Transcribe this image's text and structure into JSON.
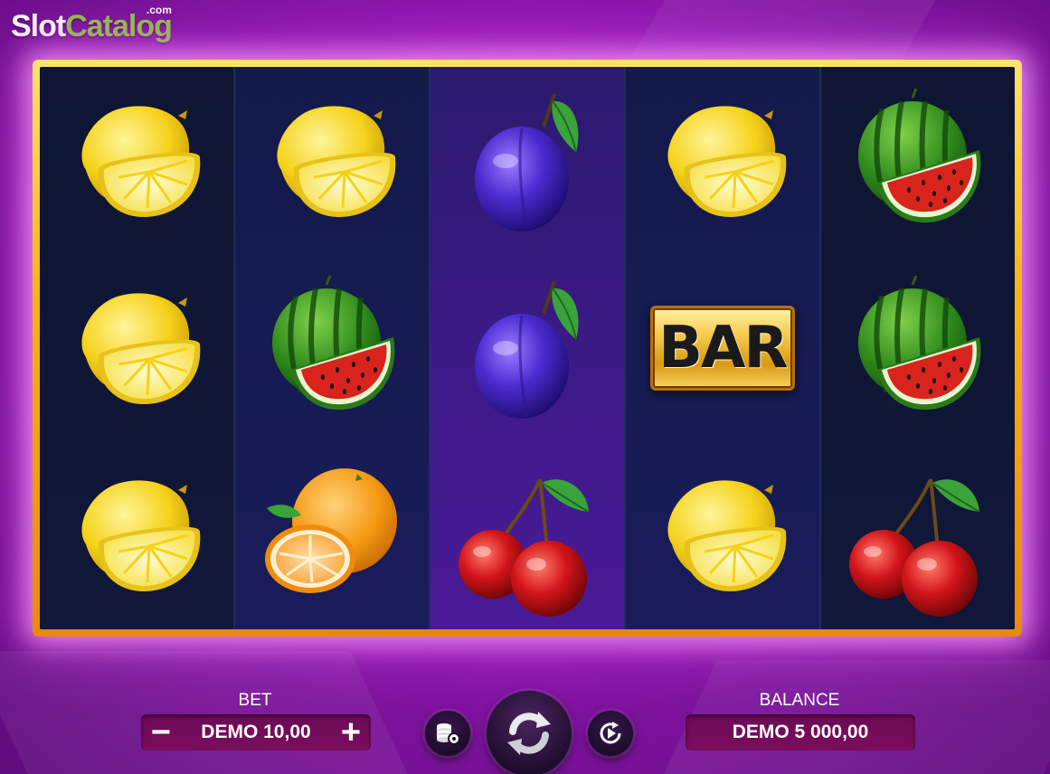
{
  "logo": {
    "slot": "Slot",
    "catalog": "Catalog",
    "com": ".com"
  },
  "reels": [
    [
      "lemon",
      "lemon",
      "lemon"
    ],
    [
      "lemon",
      "watermelon",
      "orange"
    ],
    [
      "plum",
      "plum",
      "cherry"
    ],
    [
      "lemon",
      "bar",
      "lemon"
    ],
    [
      "watermelon",
      "watermelon",
      "cherry"
    ]
  ],
  "bar_symbol": {
    "text": "BAR"
  },
  "controls": {
    "bet_label": "BET",
    "bet_value": "DEMO 10,00",
    "minus": "−",
    "plus": "+",
    "balance_label": "BALANCE",
    "balance_value": "DEMO 5 000,00",
    "icons": {
      "coins_settings": "coins-settings-icon",
      "spin": "spin-icon",
      "autoplay": "autoplay-icon"
    }
  },
  "colors": {
    "background": "#8d16ad",
    "frame_gold": "#f7b21a",
    "reel_bg": "#0d0f2b",
    "pill_bg": "#7c0d5e"
  }
}
